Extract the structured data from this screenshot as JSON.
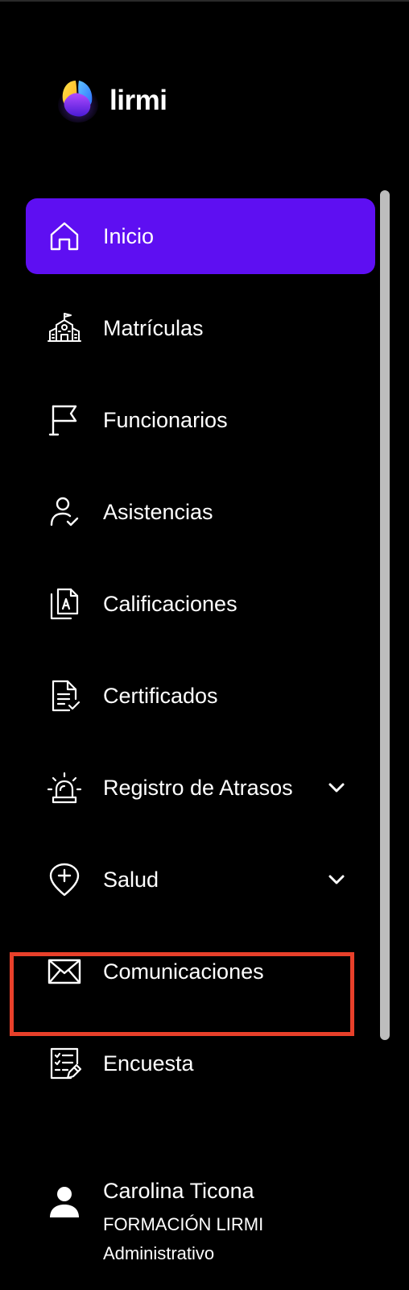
{
  "brand": {
    "name": "lirmi",
    "logo_icon": "lirmi-logo-icon"
  },
  "colors": {
    "background": "#000000",
    "active_item": "#5e0ff2",
    "highlight_border": "#e8402a",
    "scrollbar": "#bdbdbd",
    "text": "#ffffff"
  },
  "nav": {
    "items": [
      {
        "label": "Inicio",
        "icon": "home-icon",
        "active": true,
        "has_submenu": false
      },
      {
        "label": "Matrículas",
        "icon": "school-building-icon",
        "active": false,
        "has_submenu": false
      },
      {
        "label": "Funcionarios",
        "icon": "flag-icon",
        "active": false,
        "has_submenu": false
      },
      {
        "label": "Asistencias",
        "icon": "user-check-icon",
        "active": false,
        "has_submenu": false
      },
      {
        "label": "Calificaciones",
        "icon": "grade-document-icon",
        "active": false,
        "has_submenu": false
      },
      {
        "label": "Certificados",
        "icon": "certificate-document-icon",
        "active": false,
        "has_submenu": false
      },
      {
        "label": "Registro de Atrasos",
        "icon": "alarm-siren-icon",
        "active": false,
        "has_submenu": true
      },
      {
        "label": "Salud",
        "icon": "health-pin-icon",
        "active": false,
        "has_submenu": true
      },
      {
        "label": "Comunicaciones",
        "icon": "mail-icon",
        "active": false,
        "has_submenu": false,
        "highlighted": true
      },
      {
        "label": "Encuesta",
        "icon": "survey-icon",
        "active": false,
        "has_submenu": false
      }
    ]
  },
  "user": {
    "name": "Carolina Ticona",
    "organization": "FORMACIÓN LIRMI",
    "role": "Administrativo",
    "avatar_icon": "user-avatar-icon"
  }
}
